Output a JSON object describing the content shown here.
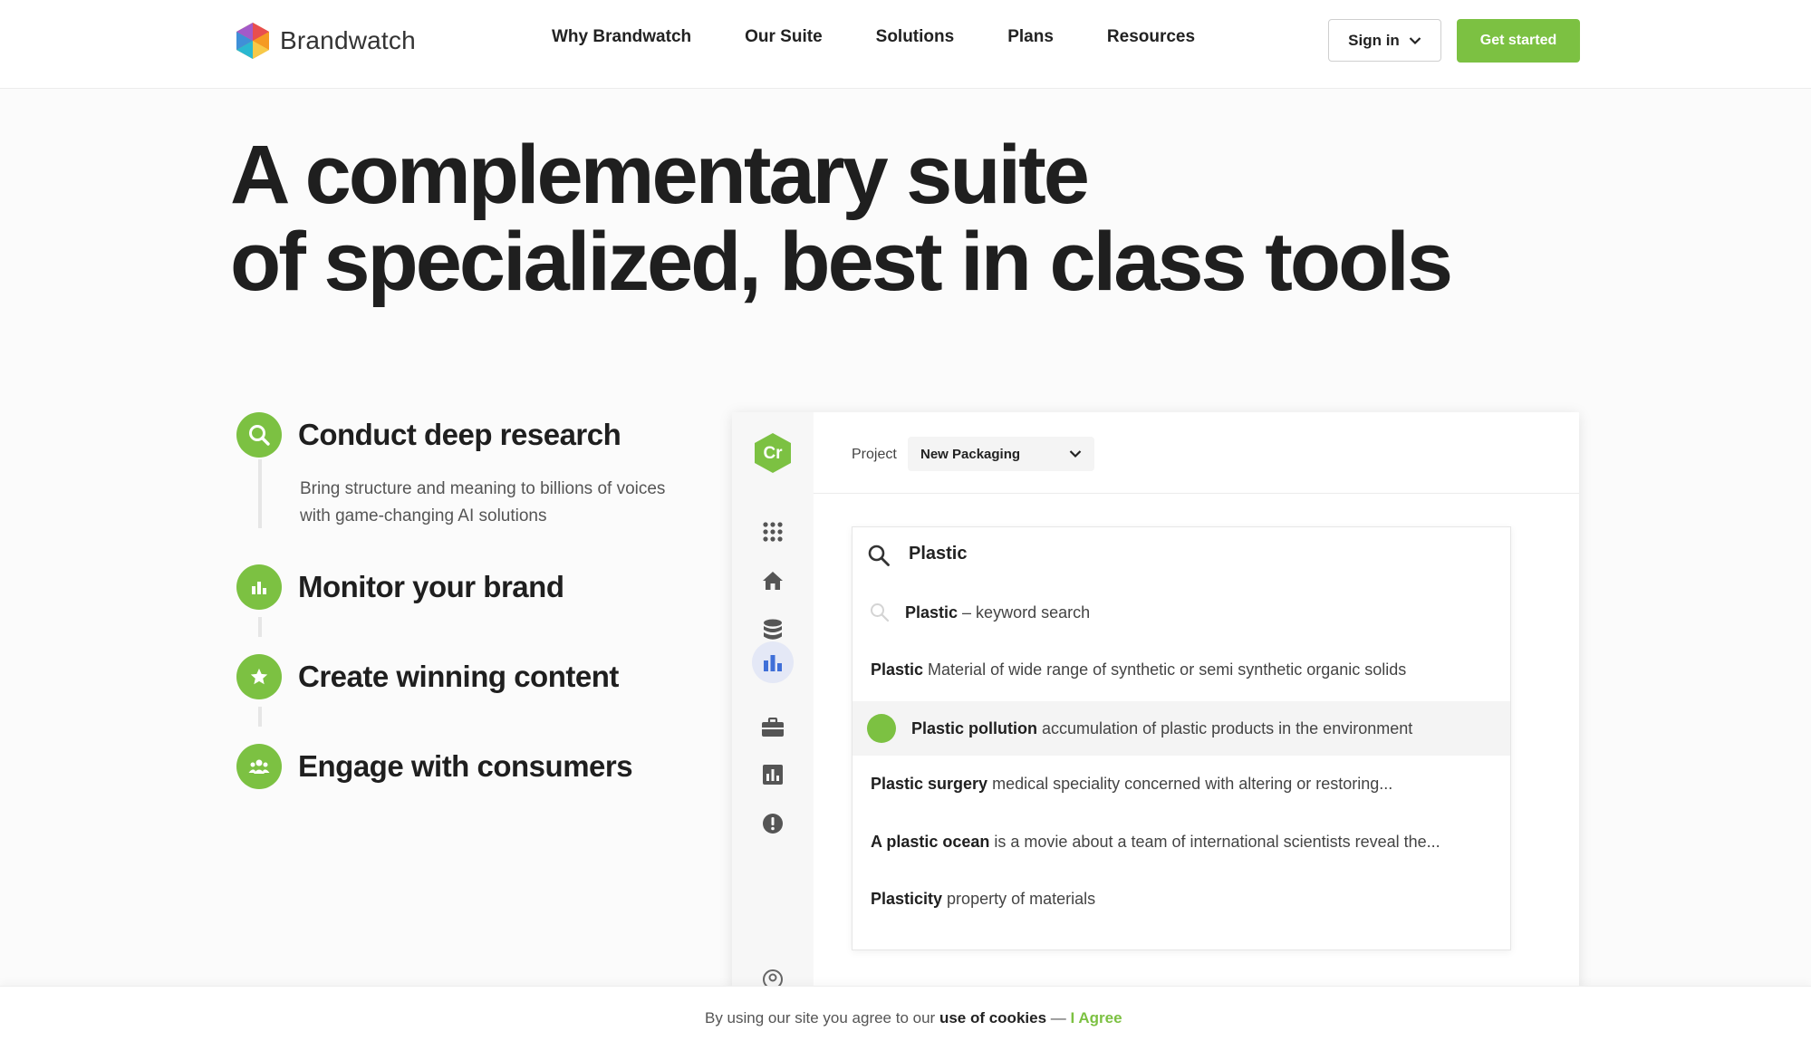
{
  "brand": {
    "name": "Brandwatch",
    "accent": "#7cc142"
  },
  "nav": {
    "items": [
      {
        "label": "Why Brandwatch"
      },
      {
        "label": "Our Suite"
      },
      {
        "label": "Solutions"
      },
      {
        "label": "Plans"
      },
      {
        "label": "Resources"
      }
    ],
    "signin_label": "Sign in",
    "cta_label": "Get started"
  },
  "hero": {
    "line1": "A complementary suite",
    "line2": "of specialized, best in class tools"
  },
  "features": [
    {
      "title": "Conduct deep research",
      "icon": "search-icon",
      "description": "Bring structure and meaning to billions of voices with game-changing AI solutions"
    },
    {
      "title": "Monitor your brand",
      "icon": "bar-chart-icon"
    },
    {
      "title": "Create winning content",
      "icon": "star-icon"
    },
    {
      "title": "Engage with consumers",
      "icon": "people-icon"
    }
  ],
  "app": {
    "logo_text": "Cr",
    "project_label": "Project",
    "project_value": "New Packaging",
    "rail_icons": [
      "apps-grid-icon",
      "home-icon",
      "database-icon",
      "bar-chart-icon",
      "briefcase-icon",
      "report-icon",
      "alert-icon",
      "location-icon"
    ],
    "search": {
      "value": "Plastic",
      "suggestions": [
        {
          "term": "Plastic",
          "desc": "– keyword search",
          "type": "keyword"
        },
        {
          "term": "Plastic",
          "desc": "Material of wide range of synthetic or semi synthetic organic solids"
        },
        {
          "term": "Plastic pollution",
          "desc": "accumulation of plastic products in the environment",
          "highlighted": true
        },
        {
          "term": "Plastic surgery",
          "desc": "medical speciality concerned with altering or restoring..."
        },
        {
          "term": "A plastic ocean",
          "desc": "is a movie about a team of international scientists reveal the..."
        },
        {
          "term": "Plasticity",
          "desc": "property of materials"
        }
      ]
    }
  },
  "cookie": {
    "prefix": "By using our site you agree to our",
    "link": "use of cookies",
    "separator": "—",
    "agree": "I Agree"
  }
}
